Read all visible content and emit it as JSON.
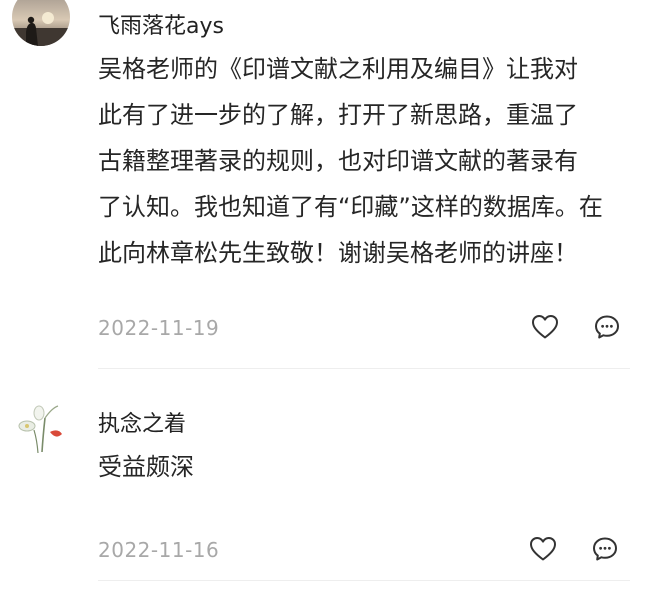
{
  "comments": [
    {
      "username": "飞雨落花ays",
      "text": "吴格老师的《印谱文献之利用及编目》让我对\n此有了进一步的了解，打开了新思路，重温了\n古籍整理著录的规则，也对印谱文献的著录有\n了认知。我也知道了有“印藏”这样的数据库。在\n此向林章松先生致敬！谢谢吴格老师的讲座！",
      "date": "2022-11-19",
      "avatar_icon": "sunset-silhouette-avatar",
      "like_icon": "heart-outline-icon",
      "reply_icon": "comment-bubble-icon"
    },
    {
      "username": "执念之着",
      "text": "受益颇深",
      "date": "2022-11-16",
      "avatar_icon": "flower-sketch-avatar",
      "like_icon": "heart-outline-icon",
      "reply_icon": "comment-bubble-icon"
    }
  ],
  "colors": {
    "text": "#262626",
    "username": "#222222",
    "date": "#a8a8a8",
    "icon": "#333333",
    "divider": "#eeeeee"
  }
}
